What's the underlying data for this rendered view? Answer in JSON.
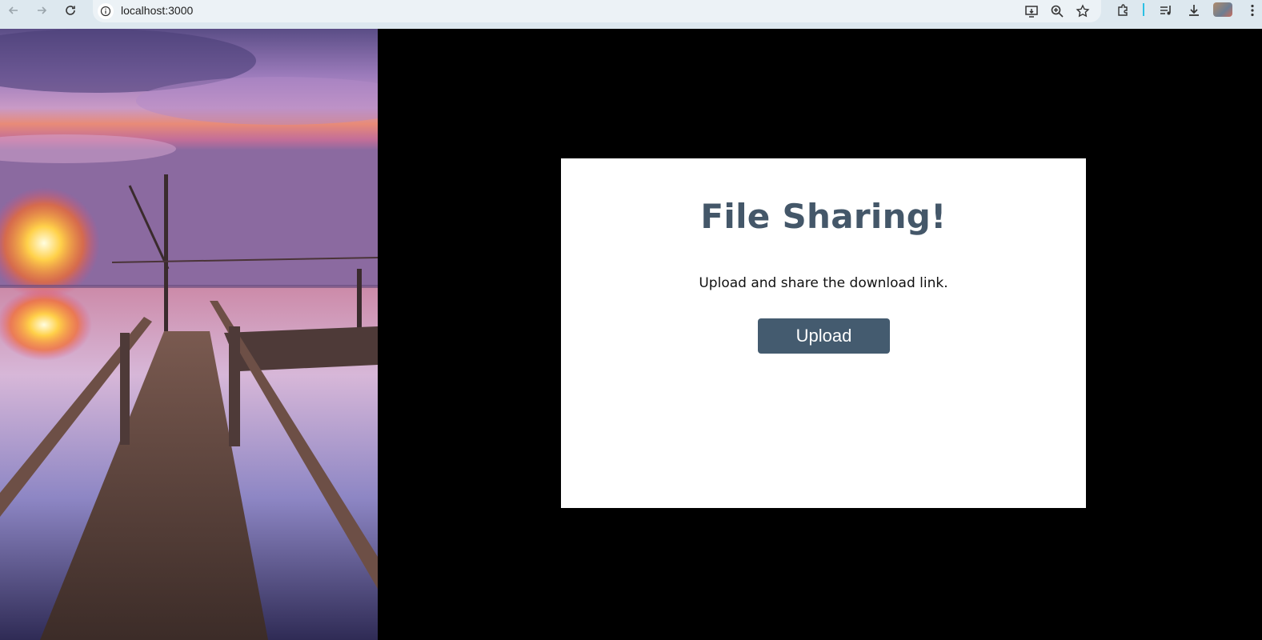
{
  "browser": {
    "url": "localhost:3000",
    "nav": {
      "back_icon": "arrow-left-icon",
      "forward_icon": "arrow-right-icon",
      "reload_icon": "reload-icon"
    },
    "omnibox_icons": [
      "site-info-icon",
      "install-app-icon",
      "zoom-icon",
      "bookmark-star-icon"
    ],
    "toolbar_icons": [
      "extensions-icon",
      "media-controls-icon",
      "downloads-icon",
      "profile-avatar",
      "menu-kebab-icon"
    ],
    "colors": {
      "frame": "#dde8ef",
      "omnibox": "#ecf2f6"
    }
  },
  "page": {
    "background": "#000000",
    "hero_image": "sunset-pier-photo",
    "card": {
      "title": "File Sharing!",
      "subtitle": "Upload and share the download link.",
      "upload_label": "Upload"
    },
    "colors": {
      "title": "#445769",
      "button": "#445b6f",
      "card": "#ffffff"
    }
  }
}
